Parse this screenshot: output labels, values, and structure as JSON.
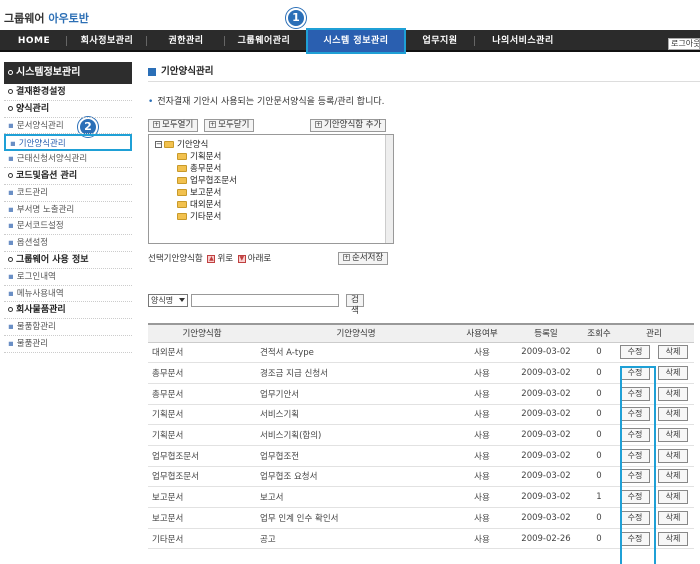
{
  "brand": {
    "prefix": "그룹웨어",
    "name": "아우토반"
  },
  "topnav": {
    "items": [
      "HOME",
      "회사정보관리",
      "권한관리",
      "그룹웨어관리",
      "시스템 정보관리",
      "업무지원",
      "나의서비스관리"
    ],
    "active_index": 4,
    "login_label": "로그아웃"
  },
  "callouts": {
    "one": "1",
    "two": "2"
  },
  "sidebar": {
    "header": "시스템정보관리",
    "rows": [
      {
        "type": "cat",
        "label": "결재환경설정"
      },
      {
        "type": "cat",
        "label": "양식관리"
      },
      {
        "type": "sub",
        "label": "문서양식관리"
      },
      {
        "type": "sub",
        "label": "기안양식관리",
        "selected": true
      },
      {
        "type": "sub",
        "label": "근태신청서양식관리"
      },
      {
        "type": "cat",
        "label": "코드및옵션 관리"
      },
      {
        "type": "sub",
        "label": "코드관리"
      },
      {
        "type": "sub",
        "label": "부서명 노출관리"
      },
      {
        "type": "sub",
        "label": "문서코드설정"
      },
      {
        "type": "sub",
        "label": "옵션설정"
      },
      {
        "type": "cat",
        "label": "그룹웨어 사용 정보"
      },
      {
        "type": "sub",
        "label": "로그인내역"
      },
      {
        "type": "sub",
        "label": "메뉴사용내역"
      },
      {
        "type": "cat",
        "label": "회사물품관리"
      },
      {
        "type": "sub",
        "label": "물품함관리"
      },
      {
        "type": "sub",
        "label": "물품관리"
      }
    ]
  },
  "content": {
    "title": "기안양식관리",
    "description": "전자결재 기안시 사용되는 기안문서양식을 등록/관리 합니다.",
    "buttons": {
      "expand_all": "모두열기",
      "collapse_all": "모두닫기",
      "add_form": "기안양식함 추가",
      "save_order": "순서저장",
      "search": "검색"
    },
    "tree": {
      "root": "기안양식",
      "children": [
        "기획문서",
        "총무문서",
        "업무협조문서",
        "보고문서",
        "대외문서",
        "기타문서"
      ]
    },
    "order": {
      "label": "선택기안양식함",
      "up": "위로",
      "down": "아래로"
    },
    "search": {
      "selected": "양식명",
      "value": ""
    },
    "table": {
      "headers": [
        "기안양식함",
        "기안양식명",
        "사용여부",
        "등록일",
        "조회수",
        "관리"
      ],
      "edit_label": "수정",
      "delete_label": "삭제",
      "rows": [
        [
          "대외문서",
          "견적서 A-type",
          "사용",
          "2009-03-02",
          "0"
        ],
        [
          "총무문서",
          "경조금 지급 신청서",
          "사용",
          "2009-03-02",
          "0"
        ],
        [
          "총무문서",
          "업무기안서",
          "사용",
          "2009-03-02",
          "0"
        ],
        [
          "기획문서",
          "서비스기획",
          "사용",
          "2009-03-02",
          "0"
        ],
        [
          "기획문서",
          "서비스기획(합의)",
          "사용",
          "2009-03-02",
          "0"
        ],
        [
          "업무협조문서",
          "업무협조전",
          "사용",
          "2009-03-02",
          "0"
        ],
        [
          "업무협조문서",
          "업무협조 요청서",
          "사용",
          "2009-03-02",
          "0"
        ],
        [
          "보고문서",
          "보고서",
          "사용",
          "2009-03-02",
          "1"
        ],
        [
          "보고문서",
          "업무 인계 인수 확인서",
          "사용",
          "2009-03-02",
          "0"
        ],
        [
          "기타문서",
          "공고",
          "사용",
          "2009-02-26",
          "0"
        ]
      ]
    }
  },
  "colors": {
    "nav_bg": "#2b2b2b",
    "active": "#2a5fb0",
    "highlight": "#1fa0d6",
    "callout": "#2b6fb7"
  }
}
